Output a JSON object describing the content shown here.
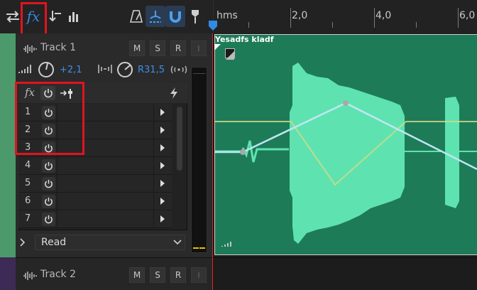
{
  "toolbar": {
    "fx_label": "fx",
    "buttons": [
      "swap-icon",
      "fx-icon",
      "send-icon",
      "eq-bars-icon",
      "metronome-icon",
      "timeline-snap-icon",
      "magnet-icon",
      "marker-icon"
    ]
  },
  "ruler": {
    "unit": "hms",
    "labels": [
      "2,0",
      "4,0",
      "6,0"
    ]
  },
  "track1": {
    "name": "Track 1",
    "mute": "M",
    "solo": "S",
    "arm": "R",
    "input": "I",
    "volume": "+2,1",
    "pan": "R31,5",
    "fx_label": "fx",
    "slots": [
      "1",
      "2",
      "3",
      "4",
      "5",
      "6",
      "7"
    ],
    "automation_mode": "Read"
  },
  "track2": {
    "name": "Track 2",
    "mute": "M",
    "solo": "S",
    "arm": "R",
    "input": "I"
  },
  "clip": {
    "name": "Yesadfs kladf"
  },
  "colors": {
    "clip": "#1e7b58",
    "waveform": "#5ee3b0",
    "track1_accent": "#4c9a6c",
    "track2_accent": "#3d2b55",
    "highlight": "#e0141e",
    "blue_value": "#3d8fe6"
  }
}
